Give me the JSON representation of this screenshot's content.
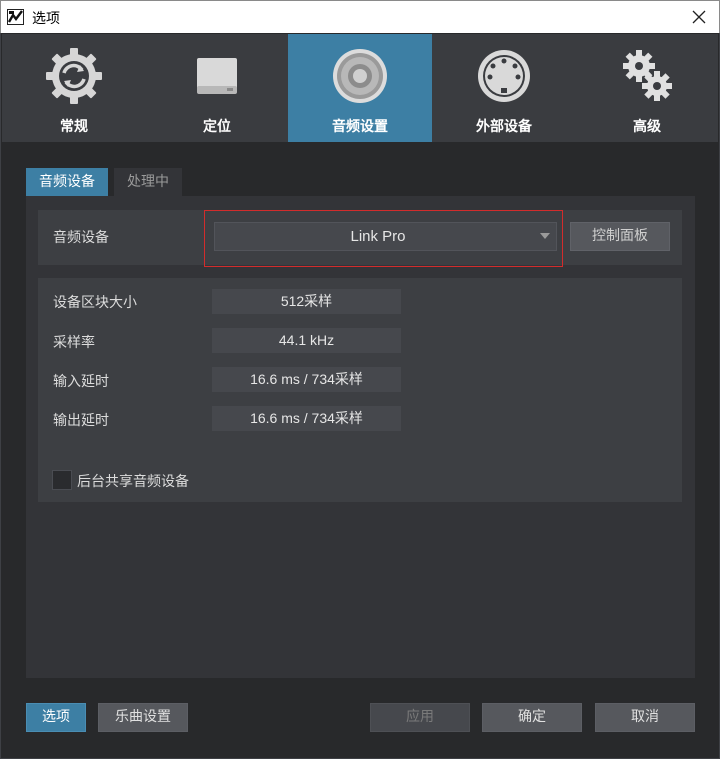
{
  "window": {
    "title": "选项"
  },
  "categories": [
    {
      "label": "常规",
      "icon": "refresh-gear-icon"
    },
    {
      "label": "定位",
      "icon": "drive-icon"
    },
    {
      "label": "音频设置",
      "icon": "speaker-icon",
      "active": true
    },
    {
      "label": "外部设备",
      "icon": "midi-port-icon"
    },
    {
      "label": "高级",
      "icon": "gears-icon"
    }
  ],
  "subtabs": [
    {
      "label": "音频设备",
      "active": true
    },
    {
      "label": "处理中"
    }
  ],
  "device": {
    "label": "音频设备",
    "selected": "Link Pro",
    "control_panel_label": "控制面板"
  },
  "info": [
    {
      "label": "设备区块大小",
      "value": "512采样"
    },
    {
      "label": "采样率",
      "value": "44.1 kHz"
    },
    {
      "label": "输入延时",
      "value": "16.6 ms / 734采样"
    },
    {
      "label": "输出延时",
      "value": "16.6 ms / 734采样"
    }
  ],
  "background_share": {
    "label": "后台共享音频设备",
    "checked": false
  },
  "footer": {
    "options_label": "选项",
    "song_settings_label": "乐曲设置",
    "apply_label": "应用",
    "ok_label": "确定",
    "cancel_label": "取消"
  },
  "colors": {
    "accent": "#3d7fa4",
    "highlight_border": "#d22c2c",
    "panel_bg": "#333438",
    "frame_bg": "#28292b"
  }
}
